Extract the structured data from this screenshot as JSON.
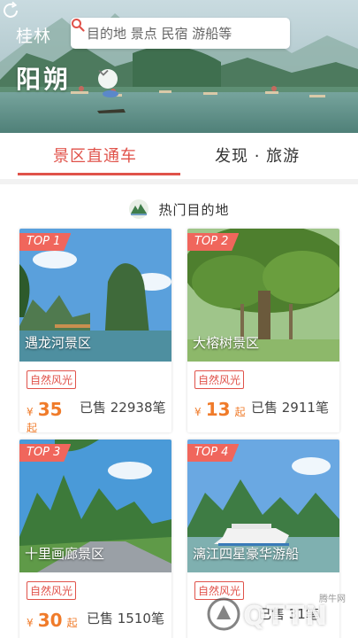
{
  "header": {
    "city": "桂林",
    "search_placeholder": "目的地 景点 民宿 游船等",
    "region": "阳朔",
    "icons": [
      "search-icon",
      "refresh-icon",
      "chevron-down-icon"
    ]
  },
  "tabs": [
    {
      "label": "景区直通车",
      "active": true
    },
    {
      "label": "发现 · 旅游",
      "active": false
    }
  ],
  "section": {
    "title": "热门目的地"
  },
  "cards": [
    {
      "rank": "TOP 1",
      "name": "遇龙河景区",
      "tag": "自然风光",
      "currency": "¥",
      "price": "35",
      "price_unit": "起",
      "sold": "已售 22938笔"
    },
    {
      "rank": "TOP 2",
      "name": "大榕树景区",
      "tag": "自然风光",
      "currency": "¥",
      "price": "13",
      "price_unit": "起",
      "sold": "已售 2911笔"
    },
    {
      "rank": "TOP 3",
      "name": "十里画廊景区",
      "tag": "自然风光",
      "currency": "¥",
      "price": "30",
      "price_unit": "起",
      "sold": "已售 1510笔"
    },
    {
      "rank": "TOP 4",
      "name": "漓江四星豪华游船",
      "tag": "自然风光",
      "currency": "¥",
      "price": "",
      "price_unit": "",
      "sold": "已售 31笔"
    }
  ],
  "watermark": {
    "text": "QTTN",
    "small": "腾牛网"
  },
  "colors": {
    "accent": "#e0524a",
    "price": "#f07b2a",
    "badge": "#f0665c"
  }
}
